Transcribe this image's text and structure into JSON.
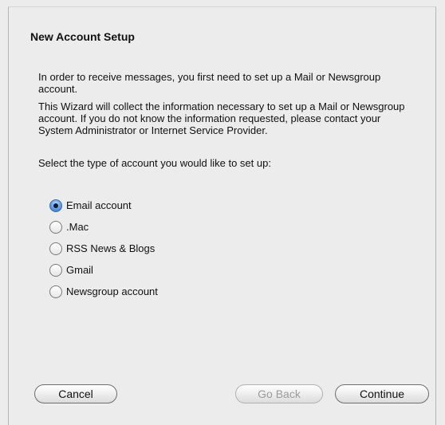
{
  "dialog": {
    "title": "New Account Setup",
    "paragraph1": "In order to receive messages, you first need to set up a Mail or Newsgroup account.",
    "paragraph2": "This Wizard will collect the information necessary to set up a Mail or Newsgroup account. If you do not know the information requested, please contact your System Administrator or Internet Service Provider.",
    "paragraph3": "Select the type of account you would like to set up:"
  },
  "options": [
    {
      "label": "Email account",
      "selected": true
    },
    {
      "label": ".Mac",
      "selected": false
    },
    {
      "label": "RSS News & Blogs",
      "selected": false
    },
    {
      "label": "Gmail",
      "selected": false
    },
    {
      "label": "Newsgroup account",
      "selected": false
    }
  ],
  "buttons": {
    "cancel": "Cancel",
    "go_back": "Go Back",
    "continue": "Continue"
  }
}
